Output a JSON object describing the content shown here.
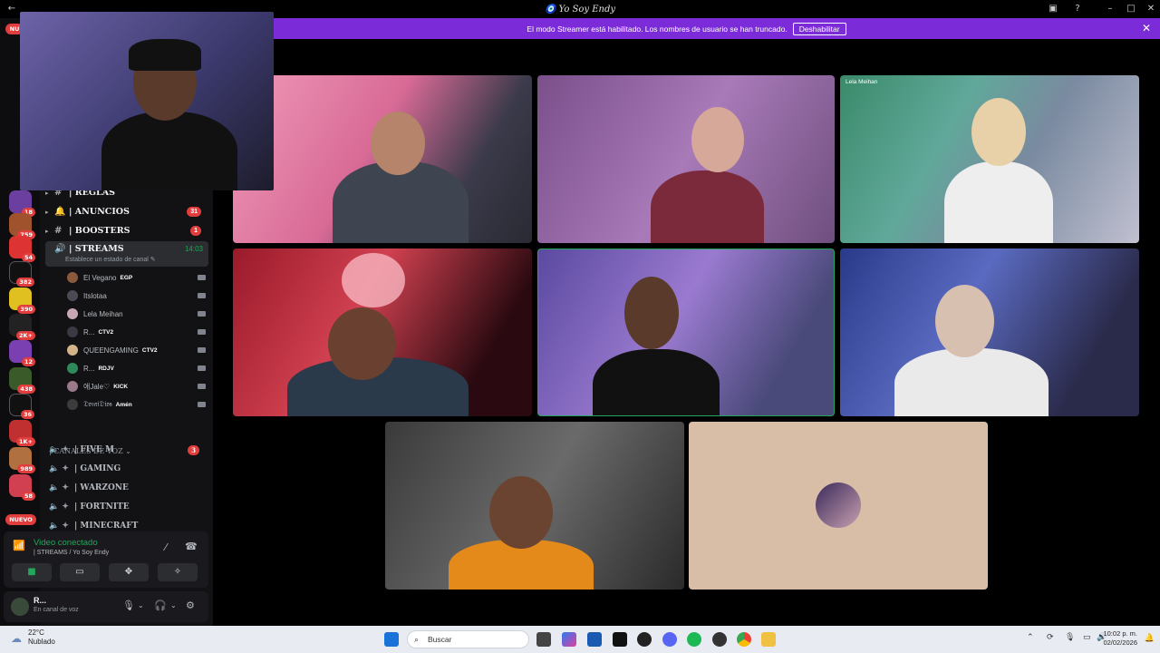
{
  "window": {
    "title": "🧿 Yo Soy Endy"
  },
  "streamer_banner": {
    "message": "El modo Streamer está habilitado. Los nombres de usuario se han truncado.",
    "button": "Deshabilitar",
    "close": "✕"
  },
  "server_rail": {
    "top_badge": "NU",
    "badges": [
      "18",
      "759",
      "54",
      "382",
      "390",
      "2K+",
      "12",
      "438",
      "36",
      "1K+",
      "989",
      "58"
    ],
    "new_label": "NUEVO"
  },
  "channels": [
    {
      "icon": "#",
      "name": "| REGLAS",
      "count": ""
    },
    {
      "icon": "🔔",
      "name": "| ANUNCIOS",
      "count": "31"
    },
    {
      "icon": "#",
      "name": "| BOOSTERS",
      "count": "1"
    }
  ],
  "active_channel": {
    "name": "| STREAMS",
    "time": "14:03",
    "status": "Establece un estado de canal ✎"
  },
  "members": [
    {
      "name": "El Vegano",
      "tag": "EGP",
      "color": "#8a5a3c"
    },
    {
      "name": "Itslotaa",
      "tag": "",
      "color": "#4a4a55"
    },
    {
      "name": "Lela Meihan",
      "tag": "",
      "color": "#c9a7b5"
    },
    {
      "name": "R...",
      "tag": "CTV2",
      "color": "#3a3a44"
    },
    {
      "name": "QUEENGAMING",
      "tag": "CTV2",
      "color": "#d3b48a"
    },
    {
      "name": "R...",
      "tag": "RDJV",
      "color": "#2e8a5a"
    },
    {
      "name": "애Jale♡",
      "tag": "KICK",
      "color": "#9a7a8a"
    },
    {
      "name": "𝔇𝔬𝔪𝔦𝔇𝔦𝔬𝔰",
      "tag": "Amén",
      "color": "#3c3c3c"
    }
  ],
  "voice_header": "| CANALES DE VOZ ⌄",
  "voice_channels": [
    {
      "name": "| FIVE M",
      "count": "3"
    },
    {
      "name": "| GAMING",
      "count": ""
    },
    {
      "name": "| WARZONE",
      "count": ""
    },
    {
      "name": "| FORTNITE",
      "count": ""
    },
    {
      "name": "| MINECRAFT",
      "count": ""
    }
  ],
  "voice_panel": {
    "title": "Video conectado",
    "subtitle": "| STREAMS / Yo Soy Endy"
  },
  "user_panel": {
    "name": "R...",
    "status": "En canal de voz"
  },
  "tiles": [
    {
      "label": ""
    },
    {
      "label": ""
    },
    {
      "label": "Lela Meihan"
    },
    {
      "label": ""
    },
    {
      "label": ""
    },
    {
      "label": ""
    },
    {
      "label": ""
    },
    {
      "label": ""
    }
  ],
  "taskbar": {
    "temp": "22°C",
    "condition": "Nublado",
    "search": "Buscar",
    "time": "10:02 p. m.",
    "date": "02/02/2026"
  },
  "colors": {
    "accent": "#7c2bd9",
    "green": "#23a55a",
    "red": "#e23d3d"
  }
}
